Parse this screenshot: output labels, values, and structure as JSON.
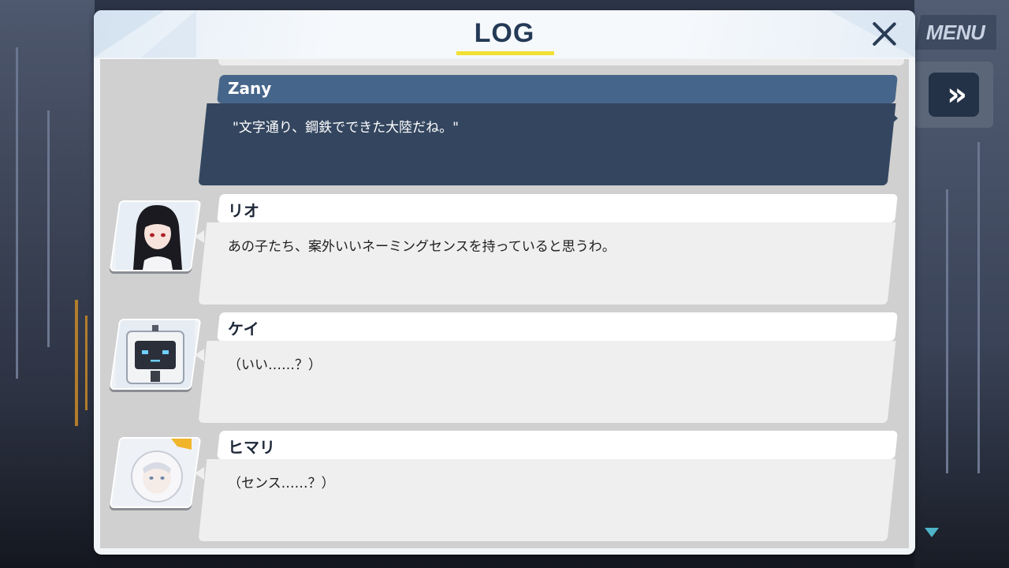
{
  "header": {
    "title": "LOG",
    "close_icon": "close-icon"
  },
  "hud": {
    "menu_label": "MENU",
    "skip_icon": "fast-forward-icon",
    "skip_glyph": "»",
    "scroll_icon": "chevron-down-icon"
  },
  "entries": [
    {
      "speaker": "Zany",
      "text": "\"文字通り、鋼鉄でできた大陸だね。\"",
      "type": "player"
    },
    {
      "speaker": "リオ",
      "text": "あの子たち、案外いいネーミングセンスを持っていると思うわ。",
      "type": "npc",
      "avatar": "rio-portrait"
    },
    {
      "speaker": "ケイ",
      "text": "（いい……？）",
      "type": "npc",
      "avatar": "kei-portrait"
    },
    {
      "speaker": "ヒマリ",
      "text": "（センス……？）",
      "type": "npc",
      "avatar": "himari-portrait"
    }
  ],
  "colors": {
    "accent_underline": "#f2e034",
    "title": "#243a56",
    "player_name_bar": "#46658a",
    "player_text_box": "#34465f"
  }
}
